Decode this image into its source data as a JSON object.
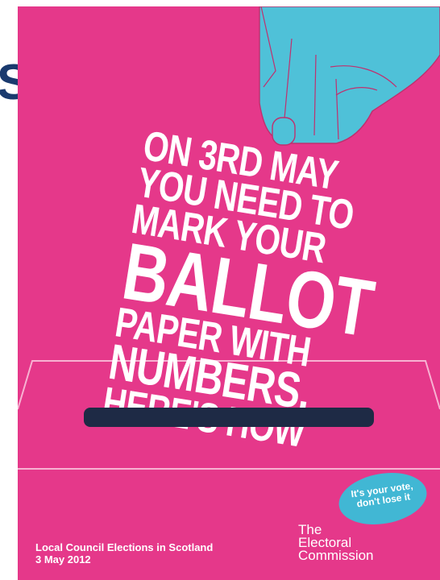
{
  "left_fragment": "S",
  "poster": {
    "headline_lines": [
      "On 3rd May",
      "You need to",
      "mark your",
      "ballot",
      "paper with",
      "numbers.",
      "Here's how"
    ],
    "event_line_1": "Local Council Elections in Scotland",
    "event_line_2": "3 May 2012",
    "bubble_line_1": "It's your vote,",
    "bubble_line_2": "don't lose it",
    "brand_line_1": "The",
    "brand_line_2": "Electoral",
    "brand_line_3": "Commission"
  },
  "colors": {
    "background": "#e5388a",
    "hand": "#4fc1d8",
    "slot": "#1e2a45",
    "bubble": "#41b7d4",
    "text": "#ffffff"
  }
}
